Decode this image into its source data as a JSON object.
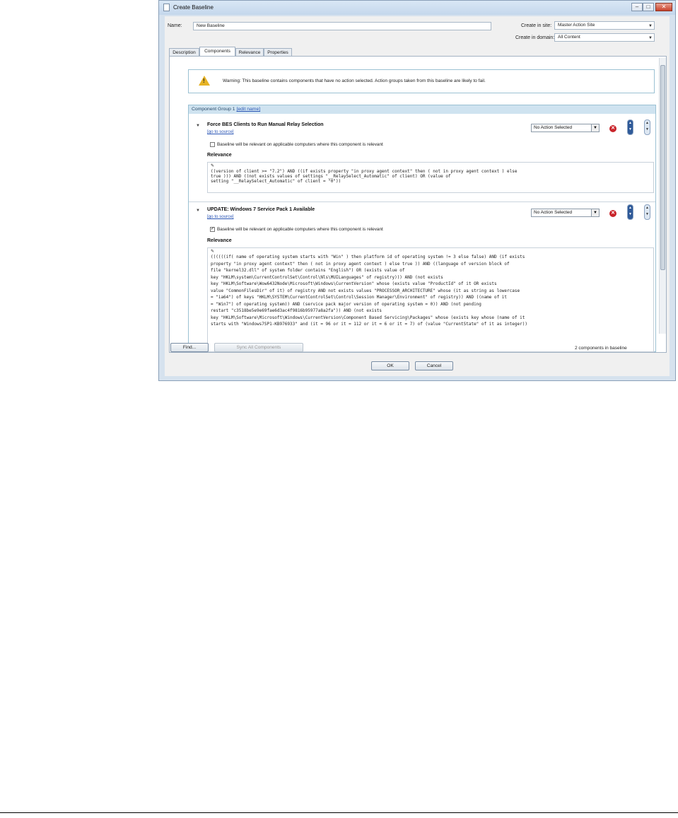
{
  "window": {
    "title": "Create Baseline",
    "min_glyph": "–",
    "max_glyph": "□",
    "close_glyph": "✕"
  },
  "form": {
    "name_label": "Name:",
    "name_value": "New Baseline",
    "site_label": "Create in site:",
    "site_value": "Master Action Site",
    "domain_label": "Create in domain:",
    "domain_value": "All Content"
  },
  "tabs": [
    "Description",
    "Components",
    "Relevance",
    "Properties"
  ],
  "active_tab": "Components",
  "warning": {
    "icon": "warning-triangle-icon",
    "text": "Warning: This baseline contains components that have no action selected. Action groups taken from this baseline are likely to fail."
  },
  "group": {
    "title": "Component Group 1",
    "edit_link": "[edit name]"
  },
  "components": [
    {
      "title": "Force BES Clients to Run Manual Relay Selection",
      "source_link": "[go to source]",
      "checkbox_checked": false,
      "checkbox_label": "Baseline will be relevant on applicable computers where this component is relevant",
      "relevance_header": "Relevance",
      "action": "No Action Selected",
      "relevance_lines": [
        "((version of client >= \"7.2\") AND ((if exists property \"in proxy agent context\" then ( not in proxy agent context ) else",
        "true ))) AND ((not exists values of settings \"__RelaySelect_Automatic\" of client) OR (value of",
        "setting \"__RelaySelect_Automatic\" of client = \"0\"))"
      ]
    },
    {
      "title": "UPDATE: Windows 7 Service Pack 1 Available",
      "source_link": "[go to source]",
      "checkbox_checked": true,
      "checkbox_label": "Baseline will be relevant on applicable computers where this component is relevant",
      "relevance_header": "Relevance",
      "action": "No Action Selected",
      "relevance_lines": [
        "((((((if( name of operating system starts with \"Win\" ) then platform id of operating system != 3 else false) AND (if exists",
        "property \"in proxy agent context\" then ( not in proxy agent context ) else true )) AND ((language of version block of",
        "file \"kernel32.dll\" of system folder contains \"English\") OR (exists value of",
        "key \"HKLM\\system\\CurrentControlSet\\Control\\Nls\\MUILanguages\" of registry))) AND (not exists",
        "key \"HKLM\\Software\\Wow6432Node\\Microsoft\\Windows\\CurrentVersion\" whose (exists value \"ProductId\" of it OR exists",
        "value \"CommonFilesDir\" of it) of registry AND not exists values \"PROCESSOR_ARCHITECTURE\" whose (it as string as lowercase",
        "= \"ia64\") of keys \"HKLM\\SYSTEM\\CurrentControlSet\\Control\\Session Manager\\Environment\" of registry)) AND ((name of it",
        "= \"Win7\") of operating system)) AND (service pack major version of operating system = 0)) AND (not pending",
        "restart \"c3518be5e9e69fae6d3ac4f9816b95977a8a2fa\")) AND (not exists",
        "key \"HKLM\\Software\\Microsoft\\Windows\\CurrentVersion\\Component Based Servicing\\Packages\" whose (exists key whose (name of it",
        "starts with \"Windows7SP1-KB976933\" and (it = 96 or it = 112 or it = 6 or it = 7) of (value \"CurrentState\" of it as integer))"
      ]
    }
  ],
  "footer": {
    "find_label": "Find...",
    "sync_label": "Sync All Components",
    "count_text": "2 components in baseline"
  },
  "dialog_buttons": {
    "ok_label": "OK",
    "cancel_label": "Cancel"
  }
}
